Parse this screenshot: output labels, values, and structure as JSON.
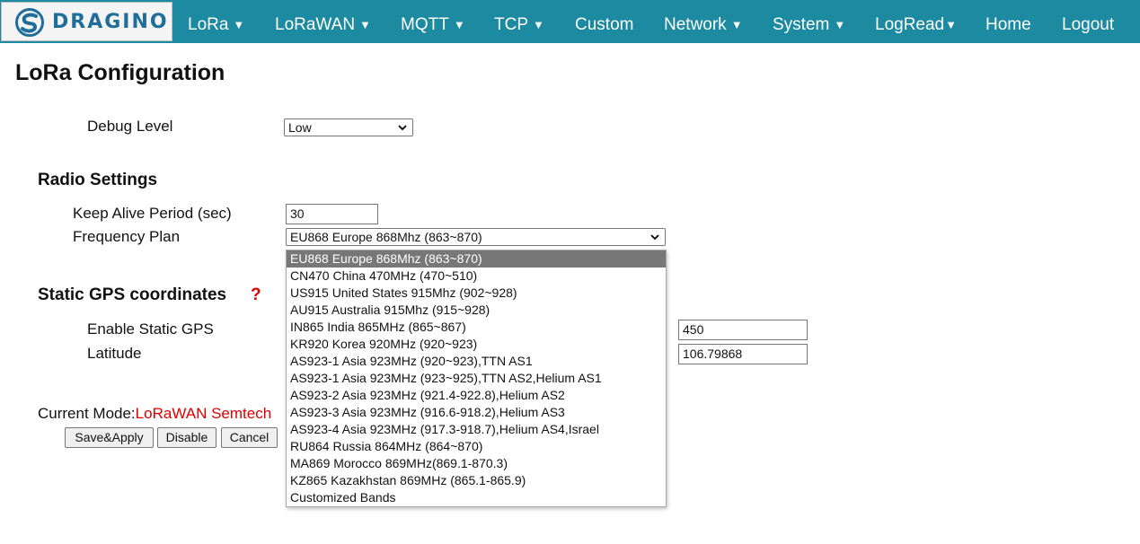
{
  "brand": {
    "name": "DRAGINO",
    "color": "#1f6e9a"
  },
  "nav": {
    "items": [
      {
        "label": "LoRa",
        "caret": "▼"
      },
      {
        "label": "LoRaWAN",
        "caret": "▼"
      },
      {
        "label": "MQTT",
        "caret": "▼"
      },
      {
        "label": "TCP",
        "caret": "▼"
      },
      {
        "label": "Custom",
        "caret": ""
      },
      {
        "label": "Network",
        "caret": "▼"
      },
      {
        "label": "System",
        "caret": "▼"
      },
      {
        "label": "LogRead",
        "caret": "▼"
      },
      {
        "label": "Home",
        "caret": ""
      },
      {
        "label": "Logout",
        "caret": ""
      }
    ],
    "background": "#1c8aa0"
  },
  "page": {
    "title": "LoRa Configuration"
  },
  "debug": {
    "label": "Debug Level",
    "value": "Low"
  },
  "radio": {
    "title": "Radio Settings",
    "keep_alive_label": "Keep Alive Period (sec)",
    "keep_alive_value": "30",
    "freq_label": "Frequency Plan",
    "freq_value": "EU868 Europe 868Mhz (863~870)"
  },
  "gps": {
    "title": "Static GPS coordinates",
    "help": "?",
    "enable_label": "Enable Static GPS",
    "latitude_label": "Latitude",
    "altitude_value": "450",
    "longitude_value": "106.79868"
  },
  "mode": {
    "label": "Current Mode:",
    "value": "LoRaWAN Semtech"
  },
  "buttons": {
    "save": "Save&Apply",
    "disable": "Disable",
    "cancel": "Cancel"
  },
  "freq_options": [
    "EU868 Europe 868Mhz (863~870)",
    "CN470 China 470MHz (470~510)",
    "US915 United States 915Mhz (902~928)",
    "AU915 Australia 915Mhz (915~928)",
    "IN865 India 865MHz (865~867)",
    "KR920 Korea 920MHz (920~923)",
    "AS923-1 Asia 923MHz (920~923),TTN AS1",
    "AS923-1 Asia 923MHz (923~925),TTN AS2,Helium AS1",
    "AS923-2 Asia 923MHz (921.4-922.8),Helium AS2",
    "AS923-3 Asia 923MHz (916.6-918.2),Helium AS3",
    "AS923-4 Asia 923MHz (917.3-918.7),Helium AS4,Israel",
    "RU864 Russia 864MHz (864~870)",
    "MA869 Morocco 869MHz(869.1-870.3)",
    "KZ865 Kazakhstan 869MHz (865.1-865.9)",
    "Customized Bands"
  ],
  "accent_red": "#e00000"
}
